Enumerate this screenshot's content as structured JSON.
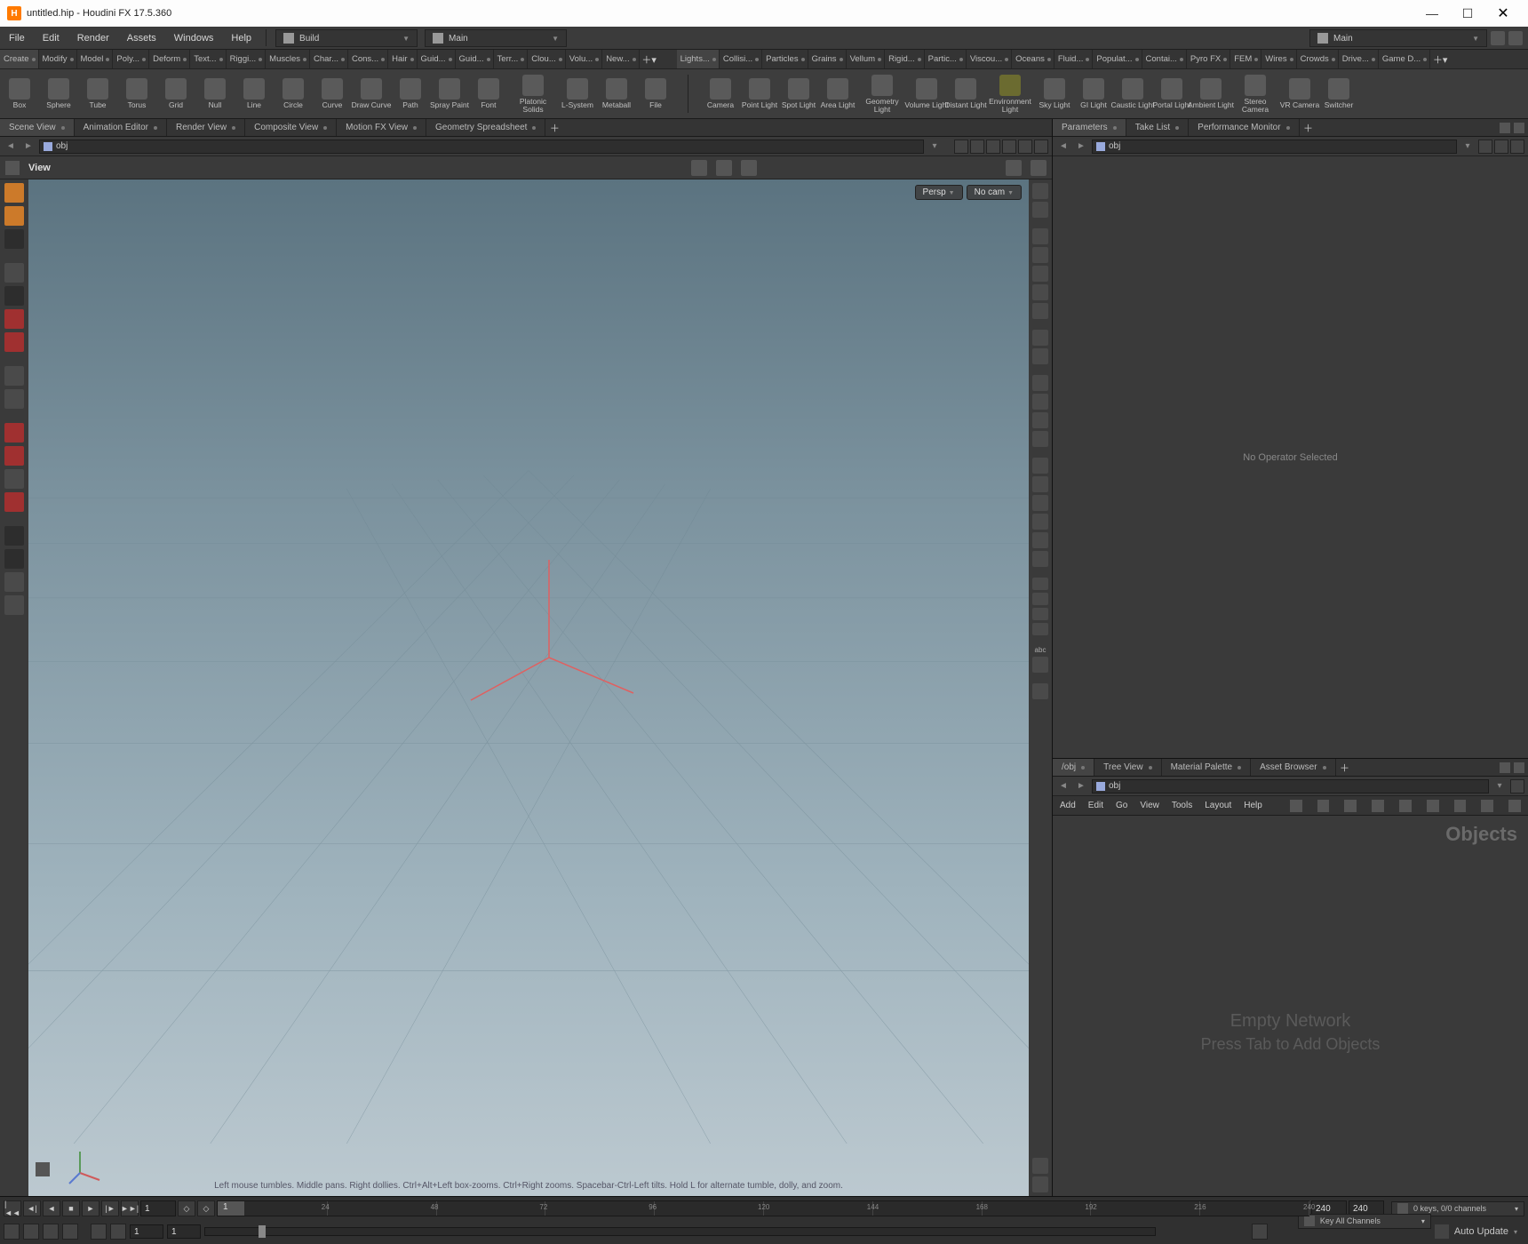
{
  "title": "untitled.hip - Houdini FX 17.5.360",
  "menus": [
    "File",
    "Edit",
    "Render",
    "Assets",
    "Windows",
    "Help"
  ],
  "desktops": {
    "left": "Build",
    "right": "Main",
    "far_right": "Main"
  },
  "shelf_left": [
    "Create",
    "Modify",
    "Model",
    "Poly...",
    "Deform",
    "Text...",
    "Riggi...",
    "Muscles",
    "Char...",
    "Cons...",
    "Hair",
    "Guid...",
    "Guid...",
    "Terr...",
    "Clou...",
    "Volu...",
    "New..."
  ],
  "shelf_right": [
    "Lights...",
    "Collisi...",
    "Particles",
    "Grains",
    "Vellum",
    "Rigid...",
    "Partic...",
    "Viscou...",
    "Oceans",
    "Fluid...",
    "Populat...",
    "Contai...",
    "Pyro FX",
    "FEM",
    "Wires",
    "Crowds",
    "Drive...",
    "Game D..."
  ],
  "tools_left": [
    {
      "l": "Box"
    },
    {
      "l": "Sphere"
    },
    {
      "l": "Tube"
    },
    {
      "l": "Torus"
    },
    {
      "l": "Grid"
    },
    {
      "l": "Null"
    },
    {
      "l": "Line"
    },
    {
      "l": "Circle"
    },
    {
      "l": "Curve"
    },
    {
      "l": "Draw Curve"
    },
    {
      "l": "Path"
    },
    {
      "l": "Spray Paint"
    },
    {
      "l": "Font"
    },
    {
      "l": "Platonic\nSolids",
      "w": true
    },
    {
      "l": "L-System"
    },
    {
      "l": "Metaball"
    },
    {
      "l": "File"
    }
  ],
  "tools_right": [
    {
      "l": "Camera"
    },
    {
      "l": "Point Light"
    },
    {
      "l": "Spot Light"
    },
    {
      "l": "Area Light"
    },
    {
      "l": "Geometry\nLight",
      "w": true
    },
    {
      "l": "Volume Light"
    },
    {
      "l": "Distant Light"
    },
    {
      "l": "Environment\nLight",
      "w": true,
      "env": true
    },
    {
      "l": "Sky Light"
    },
    {
      "l": "GI Light"
    },
    {
      "l": "Caustic Light"
    },
    {
      "l": "Portal Light"
    },
    {
      "l": "Ambient Light"
    },
    {
      "l": "Stereo\nCamera",
      "w": true
    },
    {
      "l": "VR Camera"
    },
    {
      "l": "Switcher"
    }
  ],
  "panes_left": [
    "Scene View",
    "Animation Editor",
    "Render View",
    "Composite View",
    "Motion FX View",
    "Geometry Spreadsheet"
  ],
  "panes_right_top": [
    "Parameters",
    "Take List",
    "Performance Monitor"
  ],
  "panes_right_bot": [
    "/obj",
    "Tree View",
    "Material Palette",
    "Asset Browser"
  ],
  "path": "obj",
  "view_label": "View",
  "hud": {
    "persp": "Persp",
    "nocam": "No cam"
  },
  "hint": "Left mouse tumbles.  Middle pans.  Right dollies.  Ctrl+Alt+Left box-zooms.  Ctrl+Right zooms.  Spacebar-Ctrl-Left tilts.  Hold L for alternate tumble, dolly, and zoom.",
  "param_empty": "No Operator Selected",
  "net_menus": [
    "Add",
    "Edit",
    "Go",
    "View",
    "Tools",
    "Layout",
    "Help"
  ],
  "net_corner": "Objects",
  "net_empty1": "Empty Network",
  "net_empty2": "Press Tab to Add Objects",
  "timeline": {
    "frame": "1",
    "ticks": [
      "24",
      "48",
      "72",
      "96",
      "120",
      "144",
      "168",
      "192",
      "216",
      "240"
    ],
    "end1": "240",
    "end2": "240",
    "range_start": "1",
    "range_end": "1"
  },
  "quick0": "0 keys, 0/0 channels",
  "quick1": "Key All Channels",
  "auto_update": "Auto Update"
}
